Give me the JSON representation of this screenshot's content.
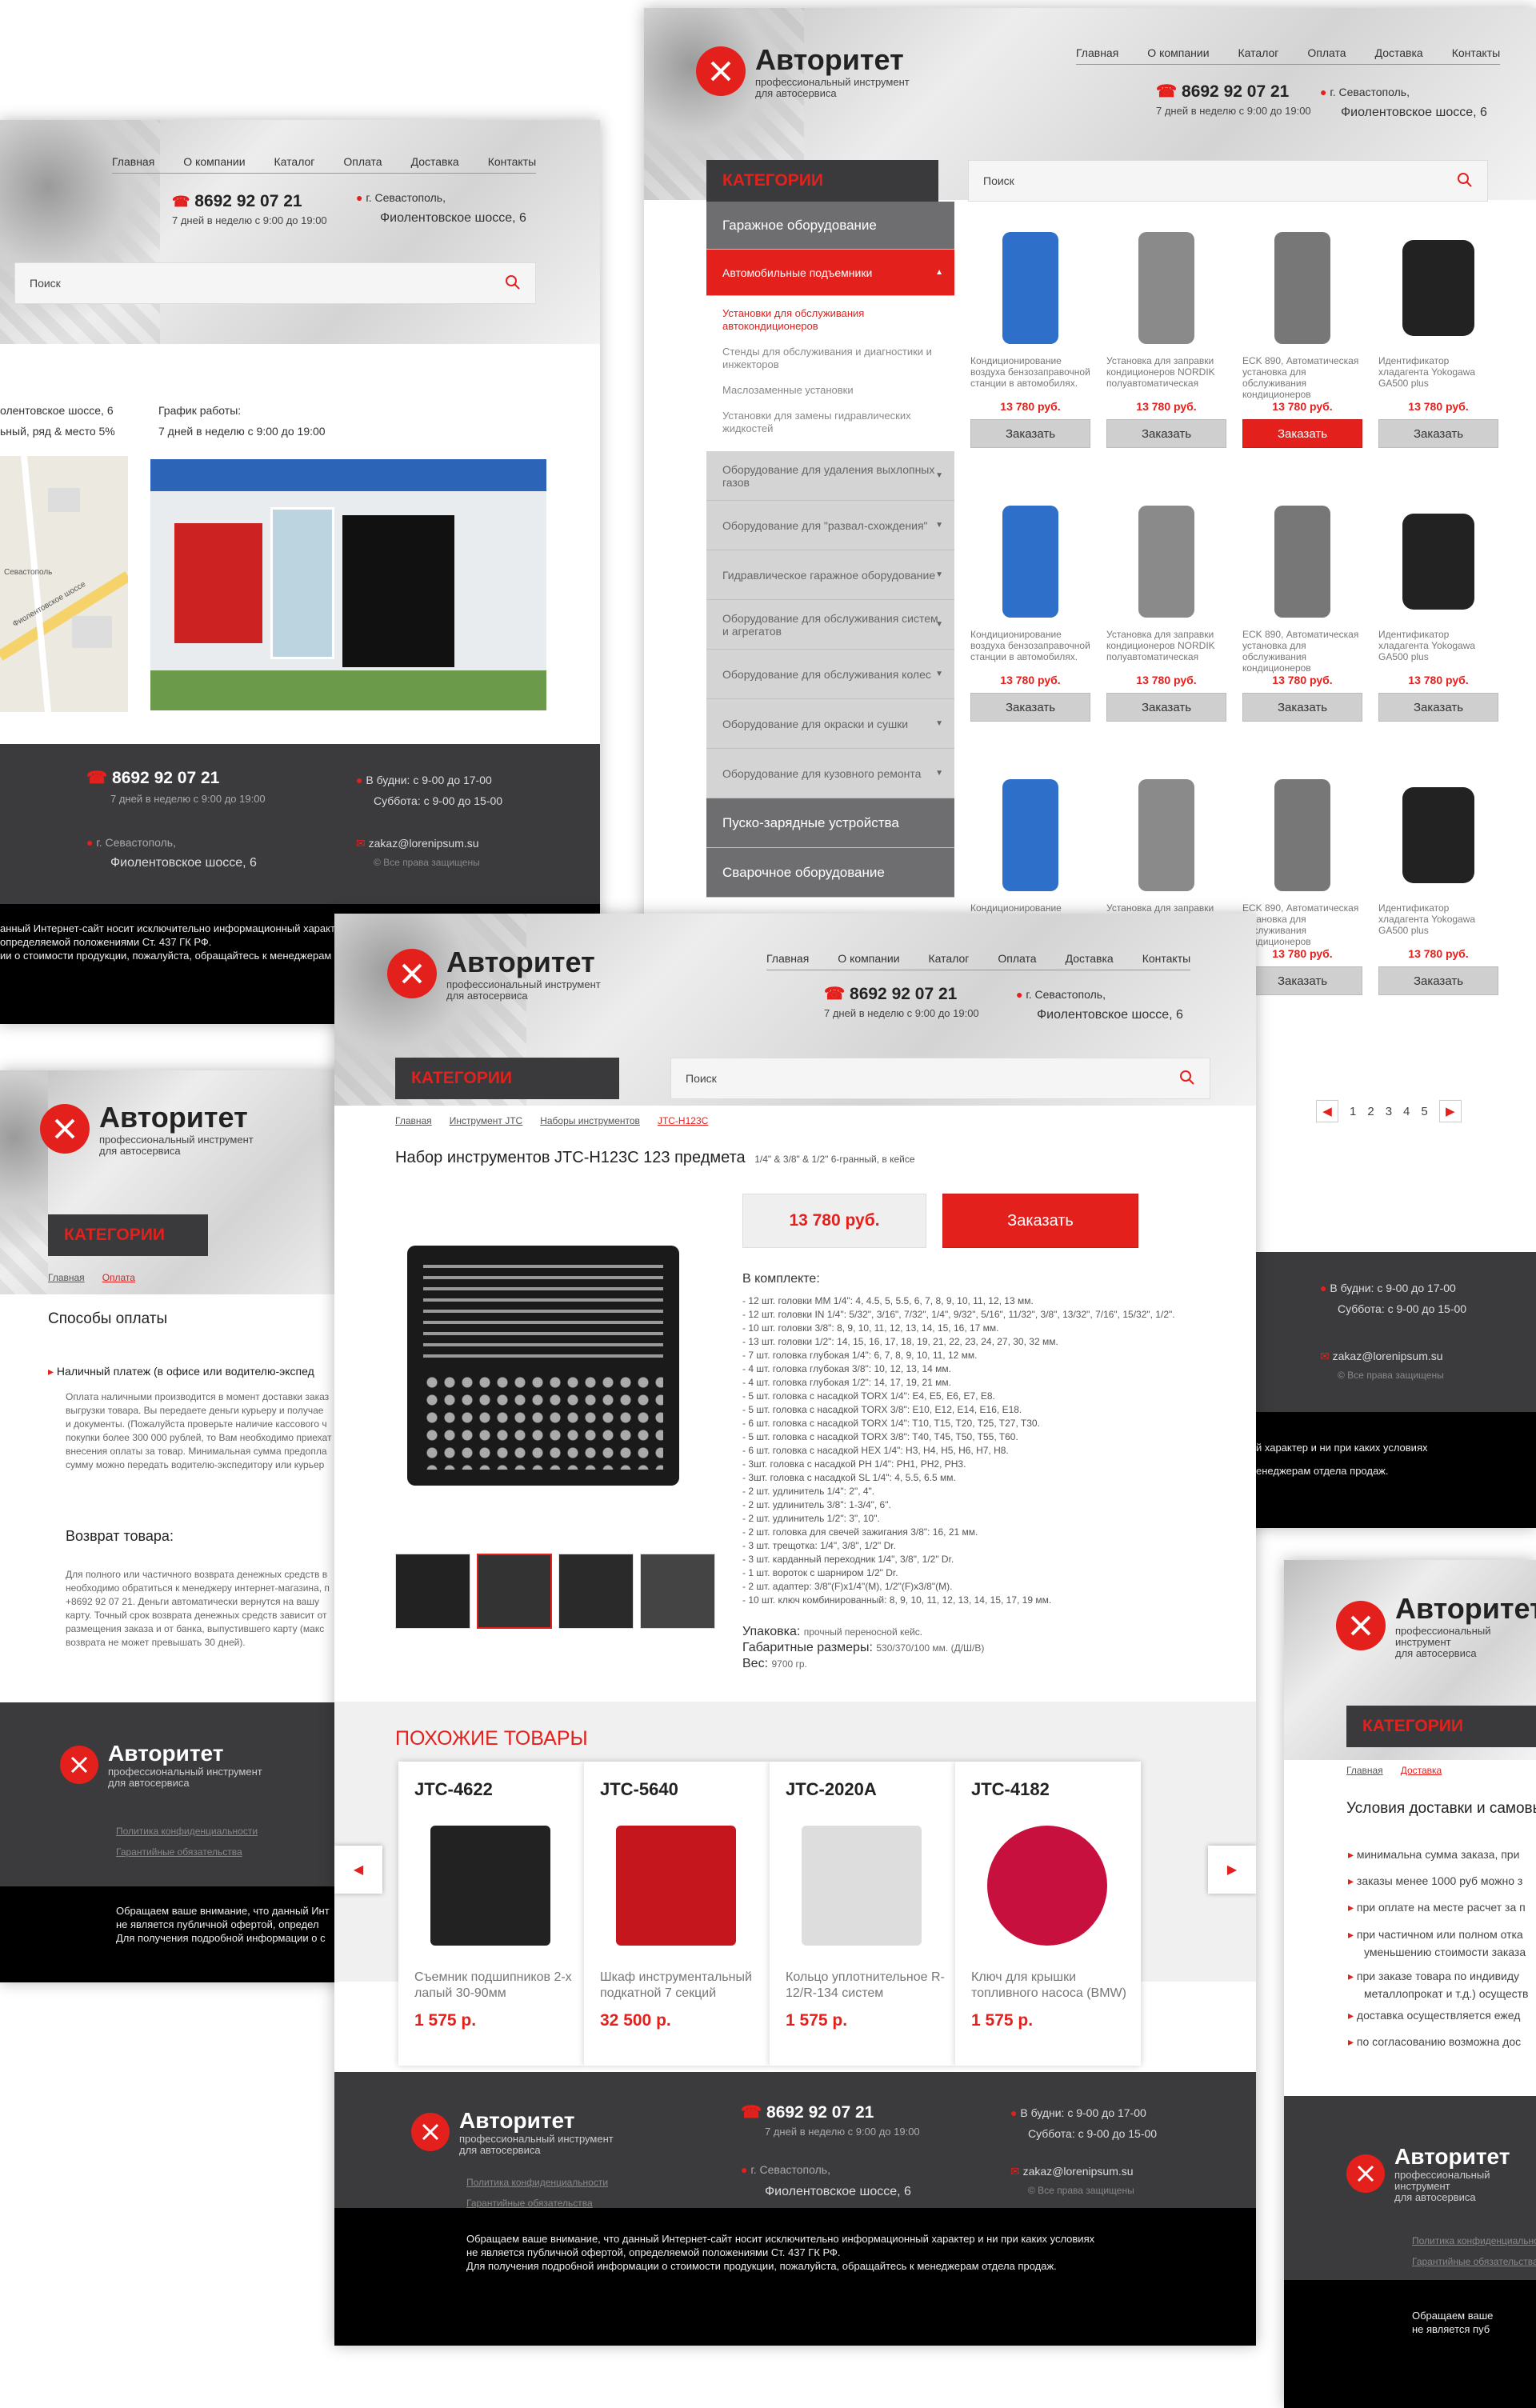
{
  "nav": [
    "Главная",
    "О компании",
    "Каталог",
    "Оплата",
    "Доставка",
    "Контакты"
  ],
  "brand": {
    "name": "Авторитет",
    "sub1": "профессиональный инструмент",
    "sub2": "для автосервиса"
  },
  "phone": {
    "number": "8692  92 07 21",
    "hours": "7 дней в неделю с 9:00 до 19:00"
  },
  "address": {
    "city": "г. Севастополь,",
    "street": "Фиолентовское шоссе, 6"
  },
  "search_placeholder": "Поиск",
  "categories_title": "КАТЕГОРИИ",
  "footer": {
    "weekdays_label": "В будни:",
    "weekdays": "с 9-00 до 17-00",
    "saturday_label": "Суббота:",
    "saturday": "с 9-00 до 15-00",
    "email": "zakaz@lorenipsum.su",
    "rights": "© Все права защищены",
    "privacy": "Политика конфиденциальности",
    "warranty": "Гарантийные обязательства",
    "notice1": "Обращаем ваше внимание, что данный Интернет-сайт носит исключительно информационный характер и ни при каких условиях",
    "notice2": "не является публичной офертой,  определяемой положениями Ст. 437 ГК РФ.",
    "notice3": "Для получения подробной информации о стоимости продукции, пожалуйста, обращайтесь к менеджерам отдела продаж."
  },
  "contacts_page": {
    "addr_line": "олентовское шоссе, 6",
    "addr_line2": "ьный, ряд & место 5%",
    "schedule_title": "График работы:",
    "schedule": "7 дней в неделю с 9:00 до 19:00",
    "map_road": "Фиолентовское шоссе",
    "map_city": "Севастополь",
    "notice1": "анный Интернет-сайт носит исключительно информационный характ",
    "notice2": "определяемой положениями Ст. 437 ГК РФ.",
    "notice3": "ии о стоимости продукции, пожалуйста, обращайтесь к менеджерам"
  },
  "catalog_page": {
    "menu": [
      {
        "label": "Гаражное оборудование",
        "type": "head"
      },
      {
        "label": "Автомобильные подъемники",
        "type": "active"
      },
      {
        "label": "Установки для обслуживания автокондиционеров",
        "type": "sub-red"
      },
      {
        "label": "Стенды для обслуживания и диагностики и инжекторов",
        "type": "sub"
      },
      {
        "label": "Маслозаменные установки",
        "type": "sub"
      },
      {
        "label": "Установки для замены гидравлических жидкостей",
        "type": "sub"
      },
      {
        "label": "Оборудование для удаления выхлопных газов",
        "type": "item"
      },
      {
        "label": "Оборудование для \"развал-схождения\"",
        "type": "item"
      },
      {
        "label": "Гидравлическое гаражное оборудование",
        "type": "item"
      },
      {
        "label": "Оборудование для обслуживания систем и агрегатов",
        "type": "item"
      },
      {
        "label": "Оборудование для обслуживания колес",
        "type": "item"
      },
      {
        "label": "Оборудование для окраски и сушки",
        "type": "item"
      },
      {
        "label": "Оборудование для кузовного ремонта",
        "type": "item"
      },
      {
        "label": "Пуско-зарядные устройства",
        "type": "head"
      },
      {
        "label": "Сварочное оборудование",
        "type": "head"
      }
    ],
    "products": [
      {
        "title": "Кондиционирование воздуха бензозаправочной станции в автомобилях.",
        "price": "13 780 руб.",
        "color": "#2d6fc9"
      },
      {
        "title": "Установка для заправки кондиционеров NORDIK полуавтоматическая",
        "price": "13 780 руб.",
        "color": "#8a8a8a"
      },
      {
        "title": "ECK 890, Автоматическая установка для обслуживания кондиционеров",
        "price": "13 780 руб.",
        "color": "#777"
      },
      {
        "title": "Идентификатор хладагента Yokogawa GA500 plus",
        "price": "13 780 руб.",
        "color": "#222"
      }
    ],
    "buy_label": "Заказать",
    "pages": [
      "1",
      "2",
      "3",
      "4",
      "5"
    ]
  },
  "payment_page": {
    "crumb1": "Главная",
    "crumb2": "Оплата",
    "title": "Способы оплаты",
    "cash_title": "Наличный платеж (в офисе или водителю-экспед",
    "cash_text": [
      "Оплата наличными производится в момент доставки заказ",
      "выгрузки товара. Вы передаете деньги курьеру и получае",
      "и документы. (Пожалуйста проверьте наличие кассового ч",
      "покупки более 300 000 рублей, то Вам необходимо приехат",
      "внесения оплаты за товар. Минимальная сумма предопла",
      "сумму можно передать водителю-экспедитору или курьер"
    ],
    "return_title": "Возврат товара:",
    "return_text": [
      "Для полного или частичного возврата денежных средств в",
      "необходимо обратиться к менеджеру интернет-магазина, п",
      "+8692 92 07 21. Деньги автоматически вернутся на вашу",
      "карту. Точный срок возврата денежных средств зависит от",
      "размещения заказа и от банка, выпустившего карту (макс",
      "возврата не может превышать 30 дней)."
    ],
    "notice1": "Обращаем ваше внимание, что данный Инт",
    "notice2": "не является публичной офертой,  определ",
    "notice3": "Для получения подробной информации о с"
  },
  "product_page": {
    "breadcrumbs": [
      "Главная",
      "Инструмент JTC",
      "Наборы инструментов",
      "JTC-H123C"
    ],
    "title": "Набор инструментов JTC-H123C 123 предмета",
    "title_note": "1/4\" & 3/8\" & 1/2\" 6-гранный, в кейсе",
    "price": "13 780 руб.",
    "order": "Заказать",
    "kit_title": "В комплекте:",
    "kit": [
      "- 12 шт. головки ММ 1/4\": 4, 4.5, 5, 5.5, 6, 7, 8, 9, 10, 11, 12, 13 мм.",
      "- 12 шт. головки IN 1/4\": 5/32\", 3/16\", 7/32\", 1/4\", 9/32\", 5/16\", 11/32\", 3/8\", 13/32\", 7/16\", 15/32\", 1/2\".",
      "- 10 шт. головки 3/8\": 8, 9, 10, 11, 12, 13, 14, 15, 16, 17 мм.",
      "- 13 шт. головки 1/2\": 14, 15, 16, 17, 18, 19, 21, 22, 23, 24, 27, 30, 32 мм.",
      "- 7 шт. головка глубокая 1/4\": 6, 7, 8, 9, 10, 11, 12 мм.",
      "- 4 шт. головка глубокая 3/8\": 10, 12, 13, 14 мм.",
      "- 4 шт. головка глубокая 1/2\": 14, 17, 19, 21 мм.",
      "- 5 шт. головка с насадкой TORX 1/4\": E4, E5, E6, E7, E8.",
      "- 5 шт. головка с насадкой TORX 3/8\": E10, E12, E14, E16, E18.",
      "- 6 шт. головка с насадкой TORX 1/4\": T10, T15, T20, T25, T27, T30.",
      "- 5 шт. головка с насадкой TORX 3/8\": T40, T45, T50, T55, T60.",
      "- 6 шт. головка с насадкой HEX 1/4\": H3, H4, H5, H6, H7, H8.",
      "- 3шт. головка с насадкой PH 1/4\": PH1, PH2, PH3.",
      "- 3шт. головка с насадкой SL 1/4\": 4, 5.5, 6.5 мм.",
      "- 2 шт. удлинитель 1/4\": 2\", 4\".",
      "- 2 шт. удлинитель 3/8\": 1-3/4\", 6\".",
      "- 2 шт. удлинитель 1/2\": 3\", 10\".",
      "- 2 шт. головка для свечей зажигания 3/8\": 16, 21 мм.",
      "- 3 шт. трещотка: 1/4\", 3/8\", 1/2\" Dr.",
      "- 3 шт. карданный переходник 1/4\", 3/8\", 1/2\" Dr.",
      "- 1 шт. вороток с шарниром 1/2\" Dr.",
      "- 2 шт. адаптер: 3/8\"(F)x1/4\"(M), 1/2\"(F)x3/8\"(M).",
      "- 10 шт. ключ комбинированный: 8, 9, 10, 11, 12, 13, 14, 15, 17, 19 мм."
    ],
    "pack_label": "Упаковка:",
    "pack": "прочный переносной кейс.",
    "dims_label": "Габаритные размеры:",
    "dims": "530/370/100 мм. (Д/Ш/В)",
    "weight_label": "Вес:",
    "weight": "9700 гр.",
    "similar_title": "ПОХОЖИЕ ТОВАРЫ",
    "similar": [
      {
        "code": "JTC-4622",
        "name": "Съемник подшипников 2-х лапый 30-90мм",
        "price": "1 575 р."
      },
      {
        "code": "JTC-5640",
        "name": "Шкаф инструментальный подкатной 7 секций",
        "price": "32 500 р."
      },
      {
        "code": "JTC-2020A",
        "name": "Кольцо уплотнительное R-12/R-134 систем",
        "price": "1 575 р."
      },
      {
        "code": "JTC-4182",
        "name": "Ключ для крышки топливного насоса (BMW)",
        "price": "1 575 р."
      }
    ]
  },
  "catalog_footer": {
    "notice1": "й характер и ни при каких условиях",
    "notice2": "енеджерам отдела продаж."
  },
  "delivery_page": {
    "crumb1": "Главная",
    "crumb2": "Доставка",
    "title": "Условия доставки и самовы",
    "items": [
      "минимальна сумма заказа, при",
      "заказы менее 1000 руб можно з",
      "при оплате на месте расчет за п",
      "при частичном или полном отка",
      "уменьшению стоимости заказа",
      "при заказе товара по индивиду",
      "металлопрокат и т.д.) осуществ",
      "доставка осуществляется ежед",
      "по согласованию возможна дос"
    ],
    "notice1": "Обращаем ваше",
    "notice2": "не является пуб"
  }
}
